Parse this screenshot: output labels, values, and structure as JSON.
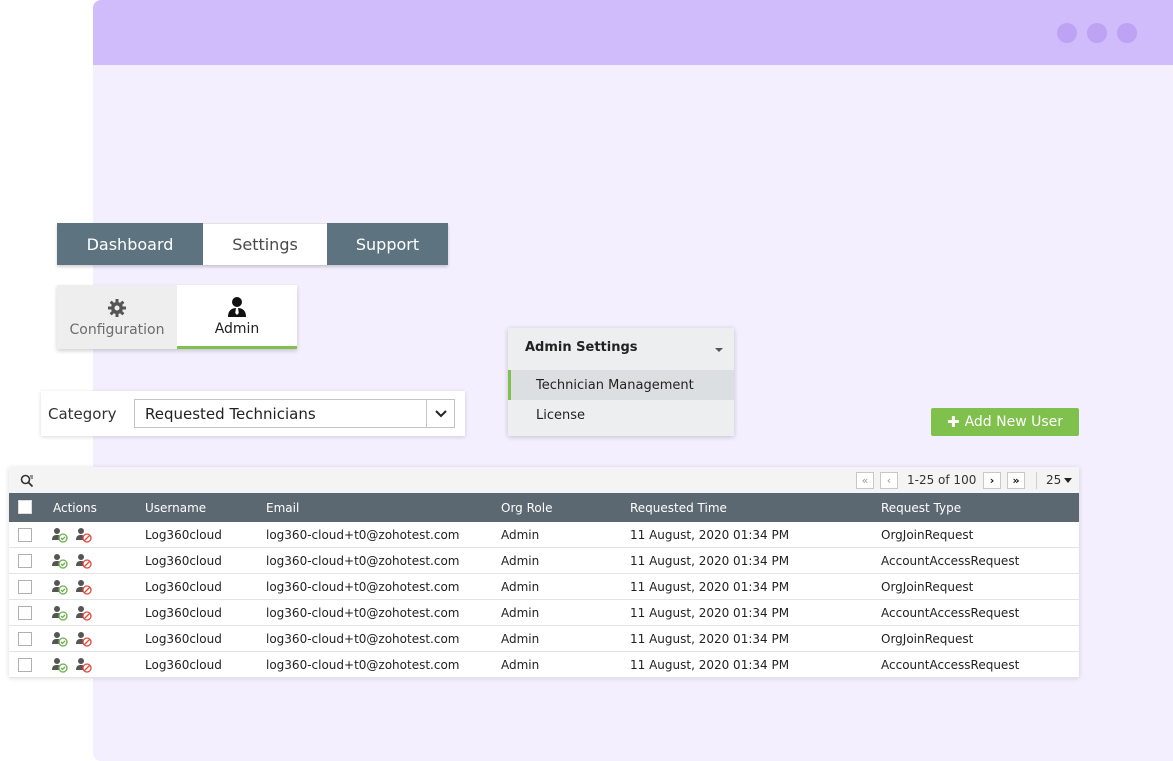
{
  "main_tabs": [
    "Dashboard",
    "Settings",
    "Support"
  ],
  "sub_tabs": [
    {
      "label": "Configuration",
      "icon": "gear-icon"
    },
    {
      "label": "Admin",
      "icon": "user-tie-icon"
    }
  ],
  "category": {
    "label": "Category",
    "value": "Requested Technicians"
  },
  "admin_settings": {
    "title": "Admin Settings",
    "items": [
      "Technician Management",
      "License"
    ]
  },
  "add_user_label": "Add New User",
  "pagination": {
    "range": "1-25 of 100",
    "page_size": "25"
  },
  "table": {
    "columns": [
      "Actions",
      "Username",
      "Email",
      "Org Role",
      "Requested Time",
      "Request Type"
    ],
    "rows": [
      {
        "username": "Log360cloud",
        "email": "log360-cloud+t0@zohotest.com",
        "role": "Admin",
        "time": "11 August, 2020 01:34 PM",
        "type": "OrgJoinRequest"
      },
      {
        "username": "Log360cloud",
        "email": "log360-cloud+t0@zohotest.com",
        "role": "Admin",
        "time": "11 August, 2020 01:34 PM",
        "type": "AccountAccessRequest"
      },
      {
        "username": "Log360cloud",
        "email": "log360-cloud+t0@zohotest.com",
        "role": "Admin",
        "time": "11 August, 2020 01:34 PM",
        "type": "OrgJoinRequest"
      },
      {
        "username": "Log360cloud",
        "email": "log360-cloud+t0@zohotest.com",
        "role": "Admin",
        "time": "11 August, 2020 01:34 PM",
        "type": "AccountAccessRequest"
      },
      {
        "username": "Log360cloud",
        "email": "log360-cloud+t0@zohotest.com",
        "role": "Admin",
        "time": "11 August, 2020 01:34 PM",
        "type": "OrgJoinRequest"
      },
      {
        "username": "Log360cloud",
        "email": "log360-cloud+t0@zohotest.com",
        "role": "Admin",
        "time": "11 August, 2020 01:34 PM",
        "type": "AccountAccessRequest"
      }
    ]
  },
  "colors": {
    "accent_green": "#80c04d",
    "tab_dark": "#5d7380",
    "header_dark": "#5b6871",
    "window_bar": "#d0bbfb",
    "window_bg": "#f3efff"
  }
}
